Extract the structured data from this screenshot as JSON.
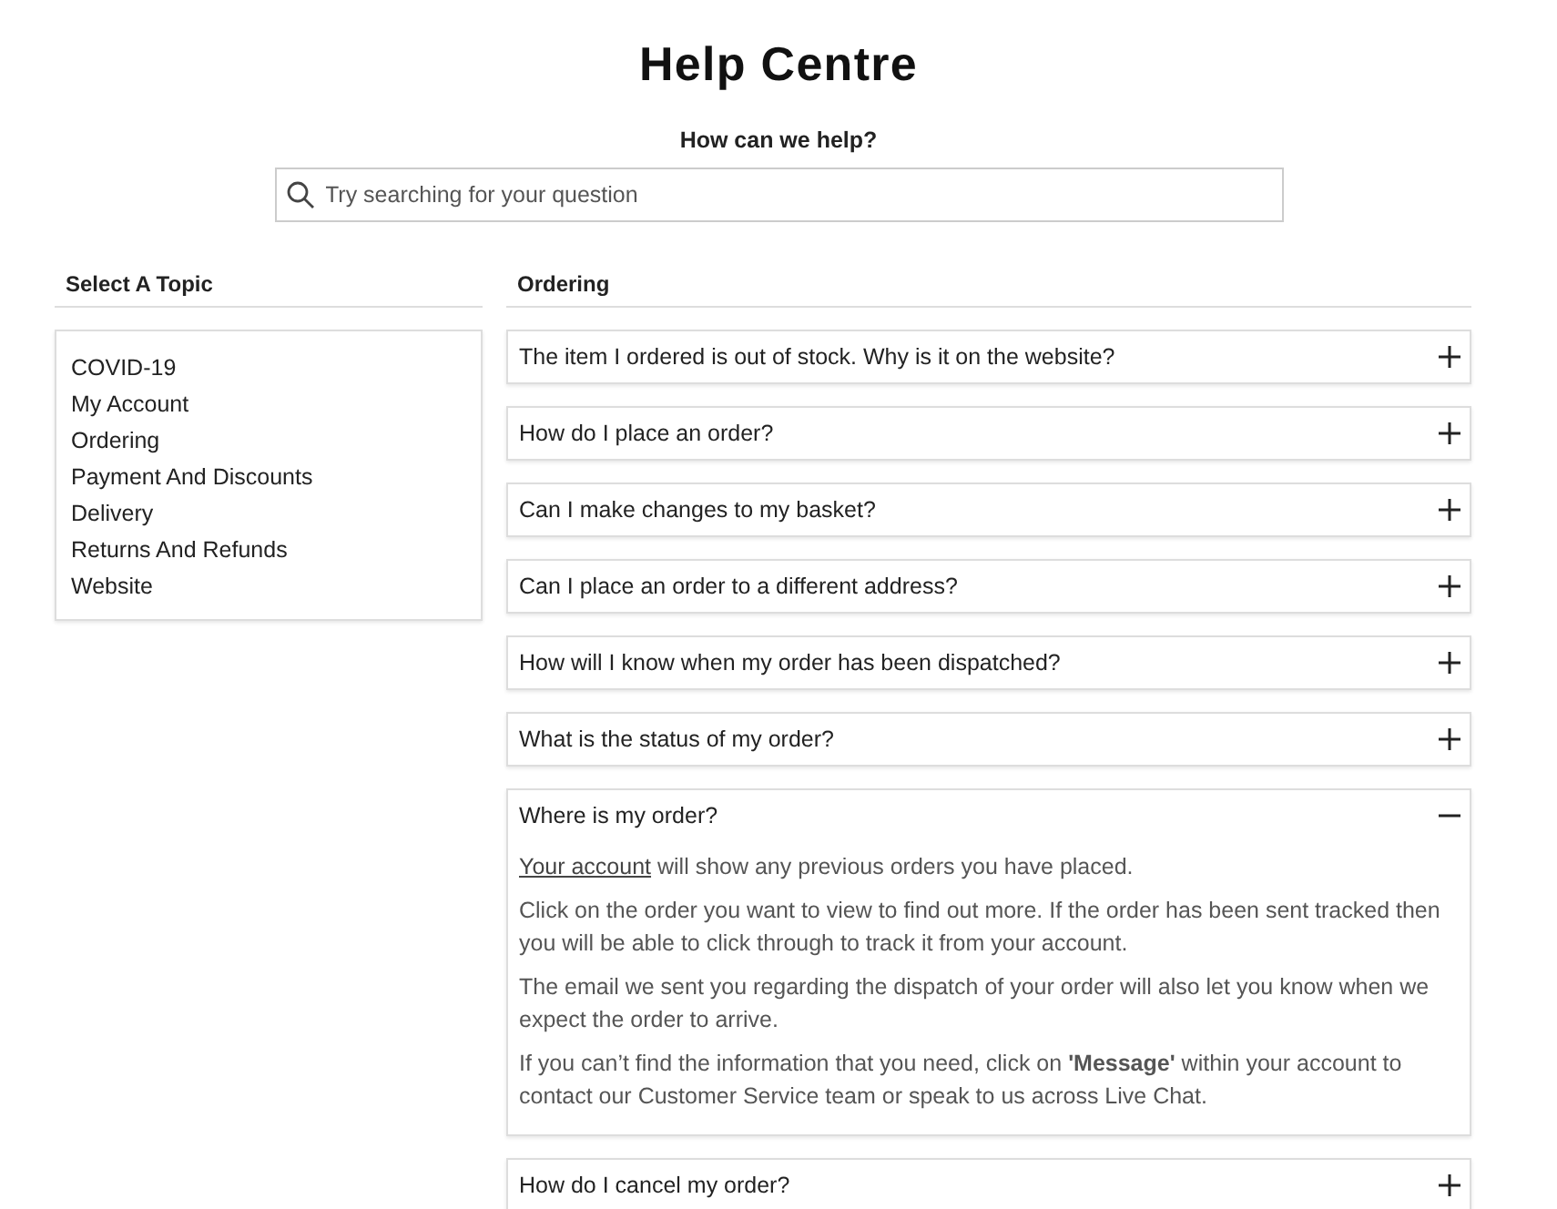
{
  "title": "Help Centre",
  "search": {
    "label": "How can we help?",
    "placeholder": "Try searching for your question"
  },
  "sidebar": {
    "heading": "Select A Topic",
    "items": [
      "COVID-19",
      "My Account",
      "Ordering",
      "Payment And Discounts",
      "Delivery",
      "Returns And Refunds",
      "Website"
    ]
  },
  "faq": {
    "heading": "Ordering",
    "items": [
      {
        "question": "The item I ordered is out of stock. Why is it on the website?",
        "expanded": false
      },
      {
        "question": "How do I place an order?",
        "expanded": false
      },
      {
        "question": "Can I make changes to my basket?",
        "expanded": false
      },
      {
        "question": "Can I place an order to a different address?",
        "expanded": false
      },
      {
        "question": "How will I know when my order has been dispatched?",
        "expanded": false
      },
      {
        "question": "What is the status of my order?",
        "expanded": false
      },
      {
        "question": "Where is my order?",
        "expanded": true,
        "answer": [
          {
            "link": "Your account",
            "text": "will show any previous orders you have placed."
          },
          {
            "text": "Click on the order you want to view to find out more. If the order has been sent tracked then you will be able to click through to track it from your account."
          },
          {
            "text": "The email we sent you regarding the dispatch of your order will also let you know when we expect the order to arrive."
          },
          {
            "text": "If you can’t find the information that you need, click on **'Message'** within your account to contact our Customer Service team or speak to us across Live Chat."
          }
        ]
      },
      {
        "question": "How do I cancel my order?",
        "expanded": false
      }
    ]
  }
}
